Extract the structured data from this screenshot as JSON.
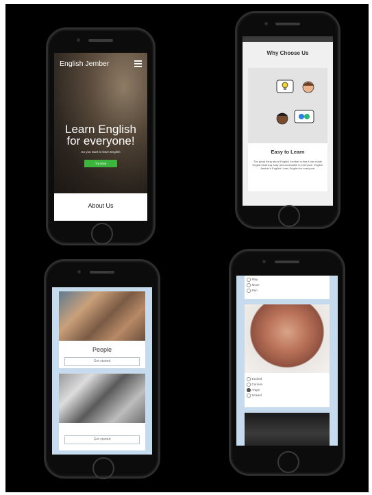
{
  "phone1": {
    "brand": "English Jember",
    "headline_line1": "Learn English",
    "headline_line2": "for everyone!",
    "subtitle": "So you want to learn English",
    "button": "Try Now",
    "section_title": "About Us"
  },
  "phone2": {
    "section_title": "Why Choose Us",
    "card_title": "Easy to Learn",
    "card_text": "The great thing about English Jember is that it has made English learning easy and accessible to everyone. English Jember's English Learn English for everyone."
  },
  "phone3": {
    "card1_title": "People",
    "card1_button": "Get started",
    "card2_button": "Get started"
  },
  "phone4": {
    "options_top": [
      "Play",
      "Move",
      "Run"
    ],
    "options_bottom": [
      "Excited",
      "Curious",
      "Angry",
      "Scared"
    ],
    "selected_option": "Angry"
  }
}
